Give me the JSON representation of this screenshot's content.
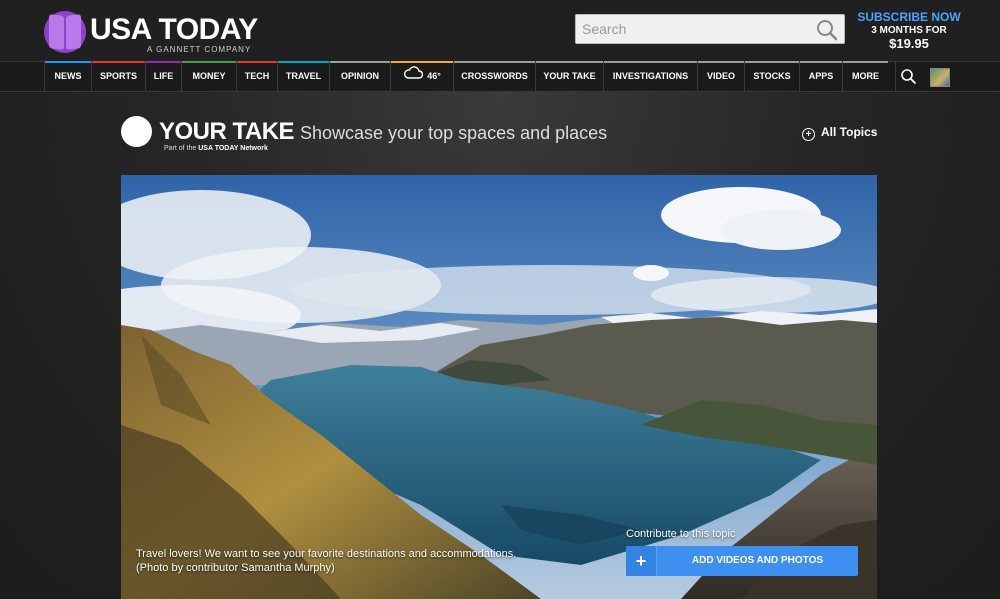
{
  "brand": {
    "logo_text": "USA TODAY",
    "logo_sub": "A GANNETT COMPANY",
    "accent_color": "#8e44c9"
  },
  "search": {
    "placeholder": "Search"
  },
  "subscribe": {
    "headline": "SUBSCRIBE NOW",
    "offer": "3 MONTHS FOR",
    "price": "$19.95"
  },
  "nav": {
    "items": [
      {
        "label": "NEWS",
        "color": "#2196f3"
      },
      {
        "label": "SPORTS",
        "color": "#e53935"
      },
      {
        "label": "LIFE",
        "color": "#9c27b0"
      },
      {
        "label": "MONEY",
        "color": "#43a047"
      },
      {
        "label": "TECH",
        "color": "#e53935"
      },
      {
        "label": "TRAVEL",
        "color": "#00acc1"
      },
      {
        "label": "OPINION",
        "color": "#9e9e9e"
      },
      {
        "label": "46°",
        "color": "#f9a825"
      },
      {
        "label": "CROSSWORDS",
        "color": "#9e9e9e"
      },
      {
        "label": "YOUR TAKE",
        "color": "#9e9e9e"
      },
      {
        "label": "INVESTIGATIONS",
        "color": "#9e9e9e"
      },
      {
        "label": "VIDEO",
        "color": "#9e9e9e"
      },
      {
        "label": "STOCKS",
        "color": "#9e9e9e"
      },
      {
        "label": "APPS",
        "color": "#9e9e9e"
      },
      {
        "label": "MORE",
        "color": "#9e9e9e"
      }
    ]
  },
  "section": {
    "title": "YOUR TAKE",
    "network_prefix": "Part of the",
    "network_name": "USA TODAY Network",
    "tagline": "Showcase your top spaces and places",
    "all_topics": "All Topics"
  },
  "hero": {
    "caption_line1": "Travel lovers! We want to see your favorite destinations and accommodations.",
    "caption_line2": "(Photo by contributor Samantha Murphy)",
    "contribute_label": "Contribute to this topic",
    "add_button": "ADD VIDEOS AND PHOTOS"
  }
}
